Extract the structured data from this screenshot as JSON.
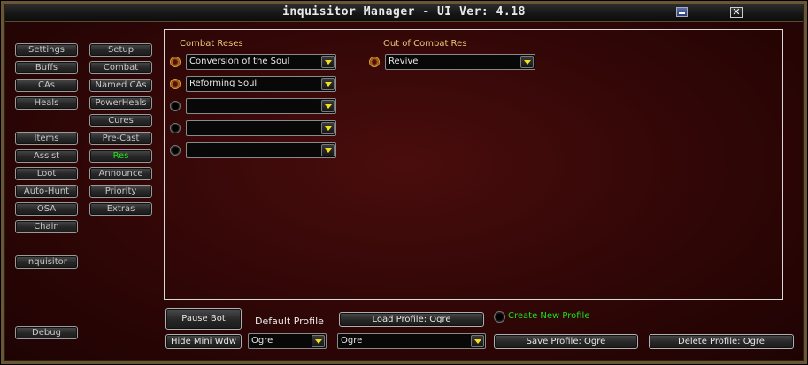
{
  "window": {
    "title": "inquisitor Manager  - UI Ver: 4.18",
    "minimize_glyph": "",
    "close_glyph": "✕"
  },
  "nav_left": [
    "Settings",
    "Buffs",
    "CAs",
    "Heals",
    "Items",
    "Assist",
    "Loot",
    "Auto-Hunt",
    "OSA",
    "Chain",
    "inquisitor",
    "Debug"
  ],
  "nav_right": [
    "Setup",
    "Combat",
    "Named CAs",
    "PowerHeals",
    "Cures",
    "Pre-Cast",
    "Res",
    "Announce",
    "Priority",
    "Extras"
  ],
  "active_tab": "Res",
  "res_panel": {
    "combat_label": "Combat Reses",
    "combat_slots": [
      "Conversion of the Soul",
      "Reforming Soul",
      "",
      "",
      ""
    ],
    "ooc_label": "Out of Combat Res",
    "ooc_slots": [
      "Revive"
    ]
  },
  "bottom": {
    "pause_label": "Pause Bot",
    "hide_mini_label": "Hide Mini Wdw",
    "default_profile_label": "Default Profile",
    "default_profile_value": "Ogre",
    "load_profile_label": "Load Profile: Ogre",
    "profile_select_value": "Ogre",
    "create_profile_label": "Create New Profile",
    "save_profile_label": "Save Profile: Ogre",
    "delete_profile_label": "Delete Profile: Ogre"
  },
  "colors": {
    "active_text": "#19e519",
    "gold_label": "#e8c878",
    "frame": "#6a5535"
  }
}
